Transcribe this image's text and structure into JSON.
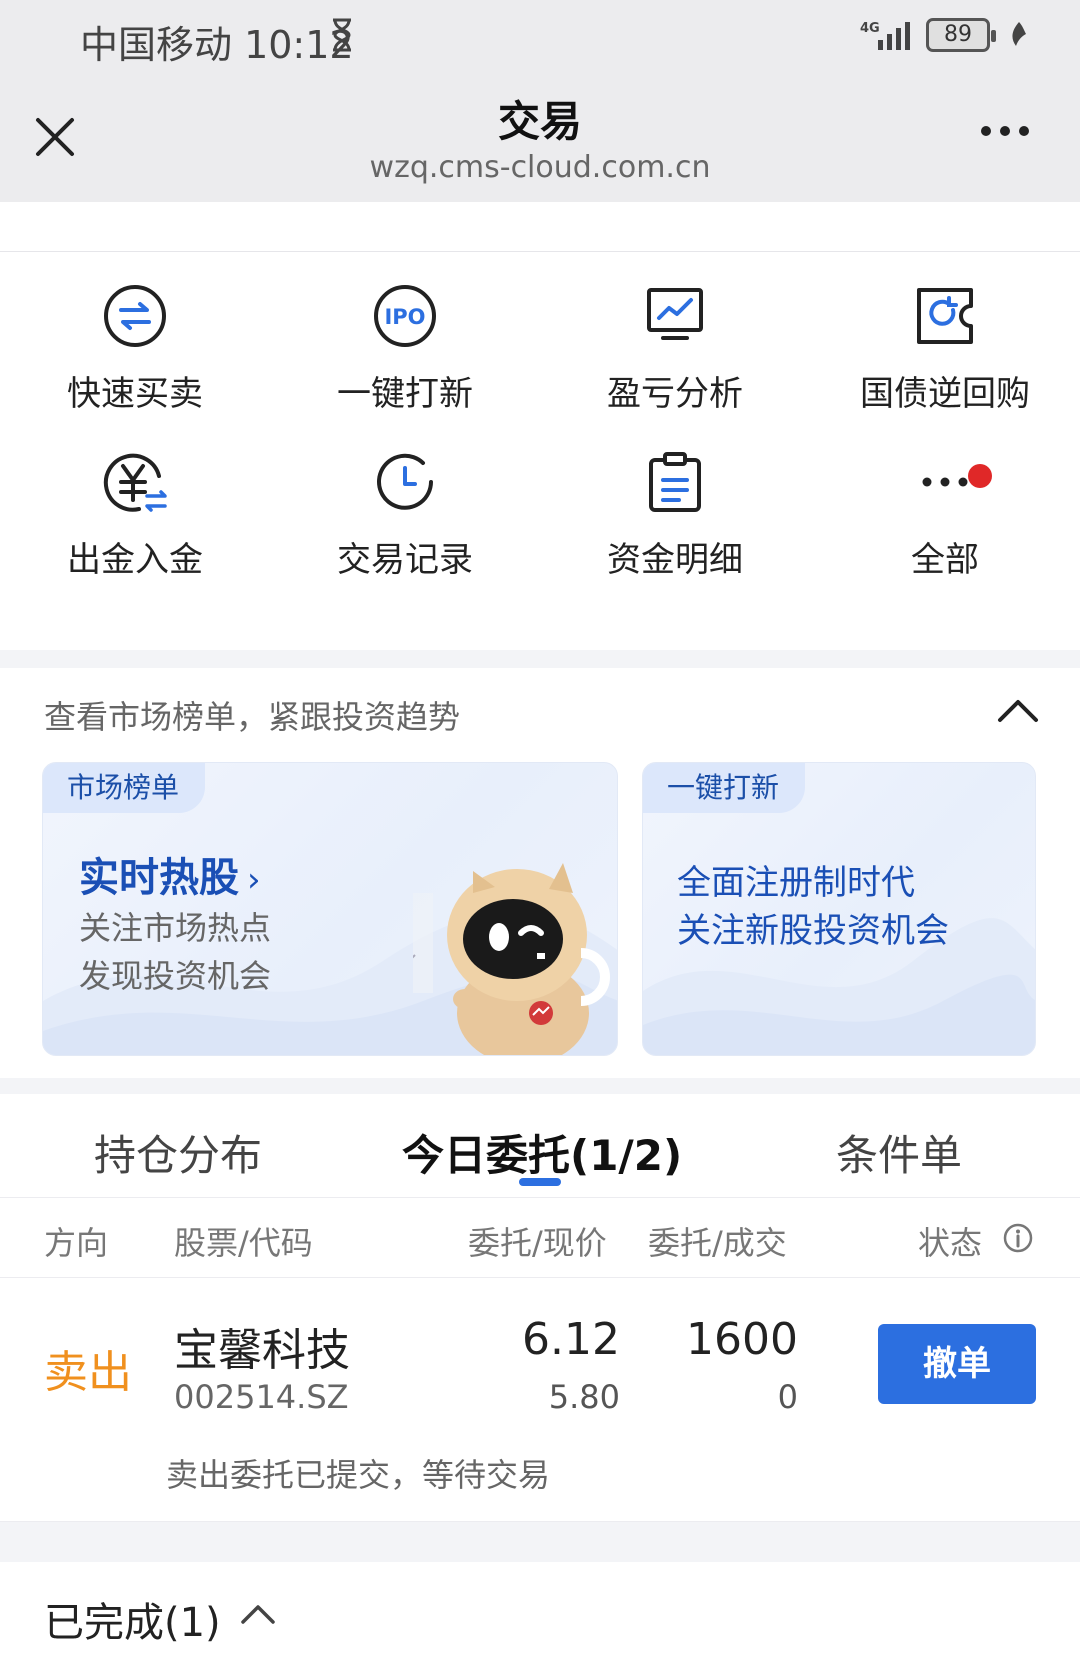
{
  "status_bar": {
    "carrier_time": "中国移动 10:12",
    "network": "4G",
    "battery": "89"
  },
  "nav": {
    "title": "交易",
    "url": "wzq.cms-cloud.com.cn"
  },
  "quick_actions": [
    {
      "label": "快速买卖",
      "icon": "swap-arrows-icon"
    },
    {
      "label": "一键打新",
      "icon": "ipo-icon"
    },
    {
      "label": "盈亏分析",
      "icon": "monitor-chart-icon"
    },
    {
      "label": "国债逆回购",
      "icon": "bond-repo-icon"
    },
    {
      "label": "出金入金",
      "icon": "yuan-transfer-icon"
    },
    {
      "label": "交易记录",
      "icon": "clock-icon"
    },
    {
      "label": "资金明细",
      "icon": "clipboard-icon"
    },
    {
      "label": "全部",
      "icon": "more-dots-icon"
    }
  ],
  "market": {
    "hint": "查看市场榜单，紧跟投资趋势",
    "left_card": {
      "tag": "市场榜单",
      "headline": "实时热股",
      "chevron": "›",
      "lines": [
        "关注市场热点",
        "发现投资机会"
      ]
    },
    "right_card": {
      "tag": "一键打新",
      "lines": [
        "全面注册制时代",
        "关注新股投资机会"
      ]
    }
  },
  "tabs": {
    "items": [
      "持仓分布",
      "今日委托(1/2)",
      "条件单"
    ],
    "active_index": 1
  },
  "table": {
    "headers": [
      "方向",
      "股票/代码",
      "委托/现价",
      "委托/成交",
      "状态"
    ]
  },
  "order": {
    "direction": "卖出",
    "name": "宝馨科技",
    "code": "002514.SZ",
    "order_price": "6.12",
    "current_price": "5.80",
    "order_qty": "1600",
    "filled_qty": "0",
    "action": "撤单",
    "note": "卖出委托已提交，等待交易"
  },
  "completed": {
    "label": "已完成(1)"
  },
  "colors": {
    "accent": "#2c6fe0",
    "sell": "#f0901e",
    "dot": "#e02828"
  }
}
